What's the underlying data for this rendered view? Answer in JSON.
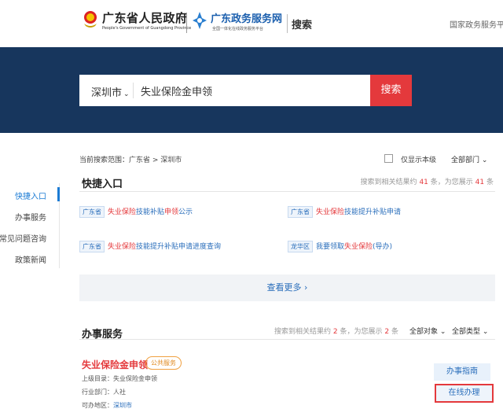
{
  "header": {
    "brand_cn": "广东省人民政府",
    "brand_en": "People's Government of Guangdong Province",
    "portal_cn": "广东政务服务网",
    "portal_sub": "全国一体化在线政务服务平台",
    "search_label": "搜索",
    "national_link": "国家政务服务平"
  },
  "search": {
    "city": "深圳市",
    "query": "失业保险金申领",
    "button": "搜索"
  },
  "nav": [
    "快捷入口",
    "办事服务",
    "常见问题咨询",
    "政策新闻"
  ],
  "scope": {
    "text": "当前搜索范围：广东省 > 深圳市",
    "only_local": "仅显示本级",
    "all_dept": "全部部门"
  },
  "quick": {
    "title": "快捷入口",
    "count_prefix": "搜索到相关结果约",
    "count_total": "41",
    "count_mid": "条，为您展示",
    "count_shown": "41",
    "count_suffix": "条",
    "entries": [
      {
        "tag": "广东省",
        "a": "失业保险",
        "b": "技能补贴",
        "c": "申领",
        "d": "公示"
      },
      {
        "tag": "广东省",
        "a": "失业保险",
        "b": "技能提升补贴申请"
      },
      {
        "tag": "广东省",
        "a": "失业保险",
        "b": "技能提升补贴申请进度查询"
      },
      {
        "tag": "龙华区",
        "a": "我要领取",
        "b": "失业保险",
        "c": "(导办)"
      }
    ],
    "more": "查看更多"
  },
  "services": {
    "title": "办事服务",
    "count_prefix": "搜索到相关结果约",
    "count_total": "2",
    "count_mid": "条，为您展示",
    "count_shown": "2",
    "count_suffix": "条",
    "filter_object": "全部对象",
    "filter_type": "全部类型",
    "item": {
      "title": "失业保险金申领",
      "badge": "公共服务",
      "parent": "上级目录：失业保险金申领",
      "dept": "行业部门：人社",
      "region_label": "可办地区：",
      "region": "深圳市",
      "guide": "办事指南",
      "online": "在线办理"
    }
  }
}
